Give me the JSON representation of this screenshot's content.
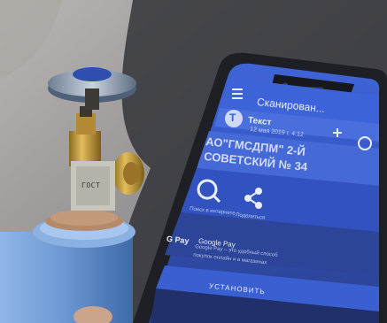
{
  "phone_screen": {
    "app_bar_title": "Сканирован...",
    "doc_initial": "Т",
    "doc_title": "Текст",
    "doc_date": "12 мая 2019 г. 4:12",
    "scan_text_line1": "АО\"ГМСДПМ\" 2-Й",
    "scan_text_line2": "СОВЕТСКИЙ № 34",
    "action_search_label": "Поиск в интернете",
    "action_share_label": "Поделиться",
    "gpay_badge": "G Pay",
    "ad_title": "Google Pay",
    "ad_line1": "Google Pay – это удобный способ",
    "ad_line2": "покупок онлайн и в магазинах",
    "install_button": "УСТАНОВИТЬ",
    "accent_color": "#3a5fd0"
  },
  "valve": {
    "stamp_text": "ГОСТ"
  }
}
